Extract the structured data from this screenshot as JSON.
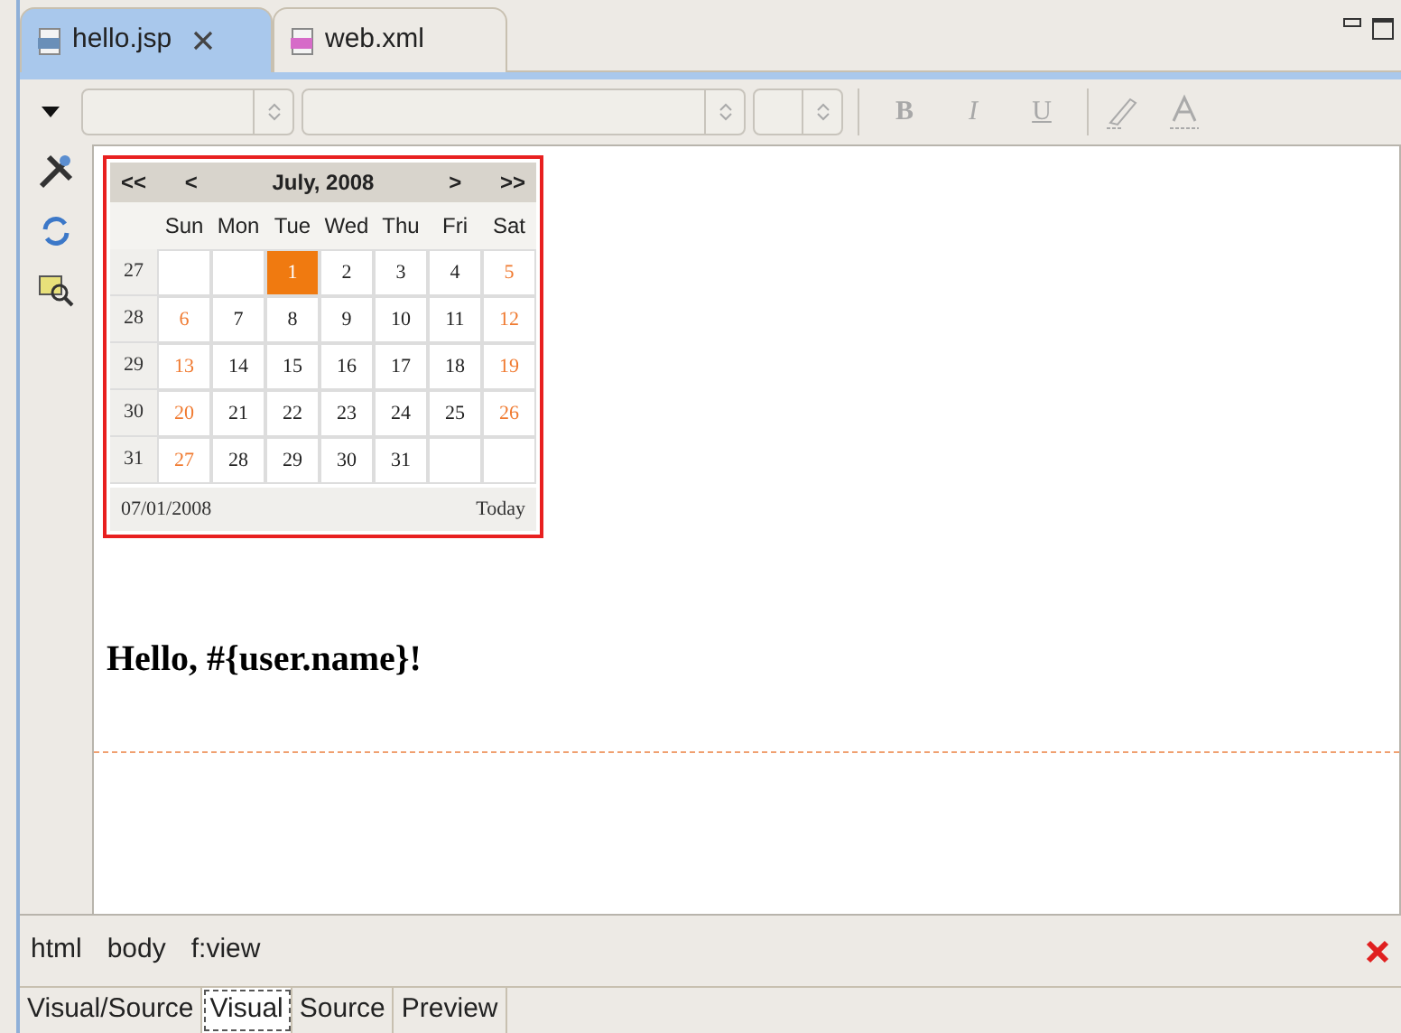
{
  "editor_tabs": [
    {
      "label": "hello.jsp",
      "selected": true,
      "closable": true,
      "kind": "jsp"
    },
    {
      "label": "web.xml",
      "selected": false,
      "closable": false,
      "kind": "xml"
    }
  ],
  "toolbar": {
    "format_buttons": [
      {
        "label": "B",
        "kind": "bold"
      },
      {
        "label": "I",
        "kind": "italic"
      },
      {
        "label": "U",
        "kind": "underline"
      }
    ]
  },
  "calendar": {
    "nav": {
      "prev_year": "<<",
      "prev_month": "<",
      "title": "July, 2008",
      "next_month": ">",
      "next_year": ">>"
    },
    "weekdays": [
      "Sun",
      "Mon",
      "Tue",
      "Wed",
      "Thu",
      "Fri",
      "Sat"
    ],
    "weeks": [
      {
        "week": "27",
        "days": [
          {
            "kind": "empty"
          },
          {
            "kind": "empty"
          },
          {
            "text": "1",
            "kind": "day",
            "selected": true
          },
          {
            "text": "2",
            "kind": "day",
            "selected": false
          },
          {
            "text": "3",
            "kind": "day",
            "selected": false
          },
          {
            "text": "4",
            "kind": "day",
            "selected": false
          },
          {
            "text": "5",
            "kind": "weekend",
            "selected": false
          }
        ]
      },
      {
        "week": "28",
        "days": [
          {
            "text": "6",
            "kind": "weekend",
            "selected": false
          },
          {
            "text": "7",
            "kind": "day",
            "selected": false
          },
          {
            "text": "8",
            "kind": "day",
            "selected": false
          },
          {
            "text": "9",
            "kind": "day",
            "selected": false
          },
          {
            "text": "10",
            "kind": "day",
            "selected": false
          },
          {
            "text": "11",
            "kind": "day",
            "selected": false
          },
          {
            "text": "12",
            "kind": "weekend",
            "selected": false
          }
        ]
      },
      {
        "week": "29",
        "days": [
          {
            "text": "13",
            "kind": "weekend",
            "selected": false
          },
          {
            "text": "14",
            "kind": "day",
            "selected": false
          },
          {
            "text": "15",
            "kind": "day",
            "selected": false
          },
          {
            "text": "16",
            "kind": "day",
            "selected": false
          },
          {
            "text": "17",
            "kind": "day",
            "selected": false
          },
          {
            "text": "18",
            "kind": "day",
            "selected": false
          },
          {
            "text": "19",
            "kind": "weekend",
            "selected": false
          }
        ]
      },
      {
        "week": "30",
        "days": [
          {
            "text": "20",
            "kind": "weekend",
            "selected": false
          },
          {
            "text": "21",
            "kind": "day",
            "selected": false
          },
          {
            "text": "22",
            "kind": "day",
            "selected": false
          },
          {
            "text": "23",
            "kind": "day",
            "selected": false
          },
          {
            "text": "24",
            "kind": "day",
            "selected": false
          },
          {
            "text": "25",
            "kind": "day",
            "selected": false
          },
          {
            "text": "26",
            "kind": "weekend",
            "selected": false
          }
        ]
      },
      {
        "week": "31",
        "days": [
          {
            "text": "27",
            "kind": "weekend",
            "selected": false
          },
          {
            "text": "28",
            "kind": "day",
            "selected": false
          },
          {
            "text": "29",
            "kind": "day",
            "selected": false
          },
          {
            "text": "30",
            "kind": "day",
            "selected": false
          },
          {
            "text": "31",
            "kind": "day",
            "selected": false
          },
          {
            "kind": "empty"
          },
          {
            "kind": "empty"
          }
        ]
      }
    ],
    "footer": {
      "date": "07/01/2008",
      "today": "Today"
    }
  },
  "heading": "Hello, #{user.name}!",
  "breadcrumbs": [
    "html",
    "body",
    "f:view"
  ],
  "bottom_tabs": [
    {
      "label": "Visual/Source",
      "selected": false
    },
    {
      "label": "Visual",
      "selected": true
    },
    {
      "label": "Source",
      "selected": false
    },
    {
      "label": "Preview",
      "selected": false
    }
  ]
}
